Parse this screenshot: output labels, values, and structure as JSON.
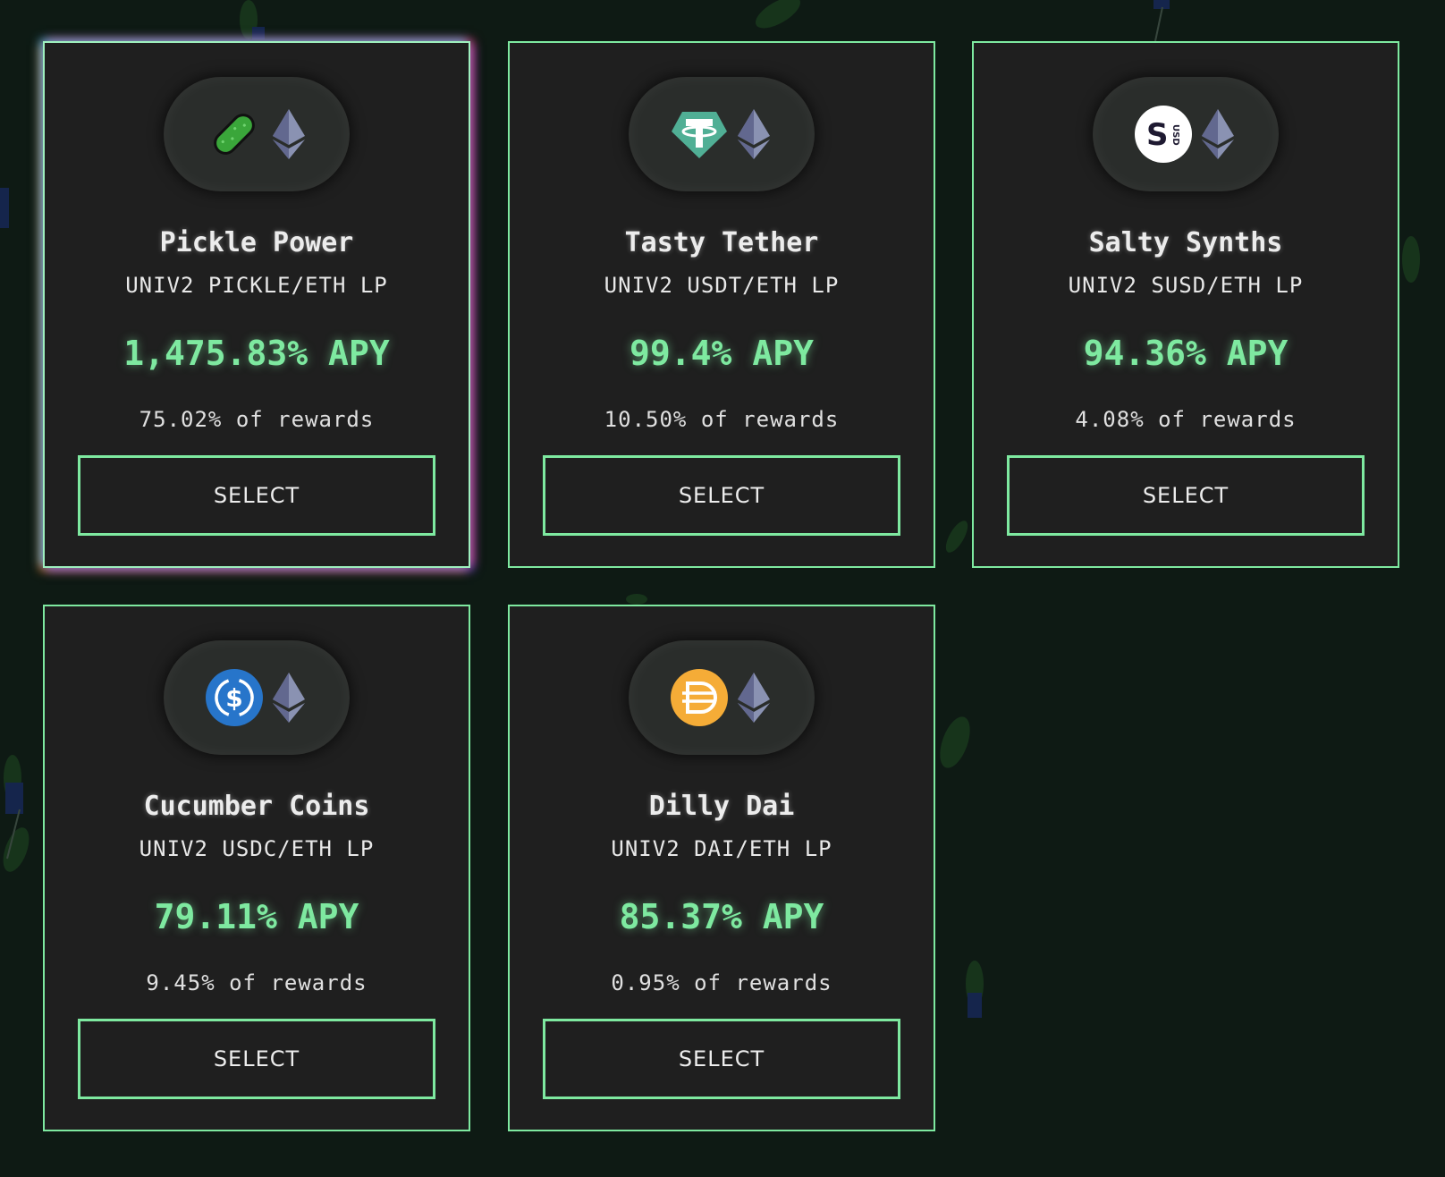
{
  "colors": {
    "background": "#0e1a14",
    "card": "#1f1f1f",
    "accent": "#7ee9a0"
  },
  "pools": [
    {
      "name": "Pickle Power",
      "lp": "UNIV2 PICKLE/ETH LP",
      "apy": "1,475.83% APY",
      "share": "75.02% of rewards",
      "button": "SELECT",
      "token_icon": "pickle-icon",
      "featured": true
    },
    {
      "name": "Tasty Tether",
      "lp": "UNIV2 USDT/ETH LP",
      "apy": "99.4% APY",
      "share": "10.50% of rewards",
      "button": "SELECT",
      "token_icon": "tether-icon"
    },
    {
      "name": "Salty Synths",
      "lp": "UNIV2 SUSD/ETH LP",
      "apy": "94.36% APY",
      "share": "4.08% of rewards",
      "button": "SELECT",
      "token_icon": "susd-icon"
    },
    {
      "name": "Cucumber Coins",
      "lp": "UNIV2 USDC/ETH LP",
      "apy": "79.11% APY",
      "share": "9.45% of rewards",
      "button": "SELECT",
      "token_icon": "usdc-icon"
    },
    {
      "name": "Dilly Dai",
      "lp": "UNIV2 DAI/ETH LP",
      "apy": "85.37% APY",
      "share": "0.95% of rewards",
      "button": "SELECT",
      "token_icon": "dai-icon"
    }
  ],
  "icons": {
    "susd_label": "USD"
  }
}
